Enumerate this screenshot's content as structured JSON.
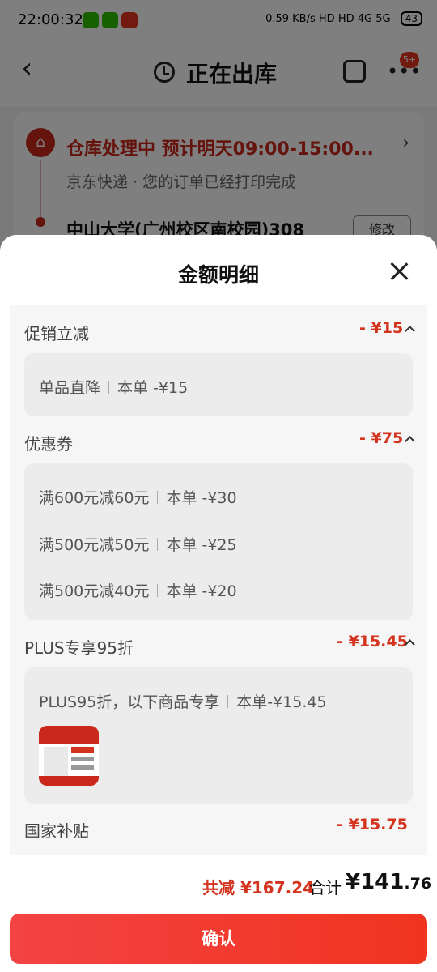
{
  "status_bar": {
    "time": "22:00:32",
    "net_speed": "0.59 KB/s",
    "signal": "HD HD 4G 5G",
    "battery": "43"
  },
  "navbar": {
    "title": "正在出库",
    "badge": "5+"
  },
  "order_card": {
    "status": "仓库处理中  预计明天09:00-15:00...",
    "sub": "京东快递 · 您的订单已经打印完成",
    "address": "中山大学(广州校区南校园)308",
    "modify_label": "修改"
  },
  "sheet": {
    "title": "金额明细",
    "sections": [
      {
        "title": "促销立减",
        "amount": "- ¥15",
        "items": [
          {
            "name": "单品直降",
            "detail": "本单 -¥15"
          }
        ]
      },
      {
        "title": "优惠券",
        "amount": "- ¥75",
        "items": [
          {
            "name": "满600元减60元",
            "detail": "本单 -¥30"
          },
          {
            "name": "满500元减50元",
            "detail": "本单 -¥25"
          },
          {
            "name": "满500元减40元",
            "detail": "本单 -¥20"
          }
        ]
      },
      {
        "title": "PLUS专享95折",
        "amount": "- ¥15.45",
        "items": [
          {
            "name": "PLUS95折，以下商品专享",
            "detail": "本单-¥15.45"
          }
        ],
        "has_thumbnail": true
      },
      {
        "title": "国家补贴",
        "amount": "- ¥15.75"
      }
    ]
  },
  "footer": {
    "total_reduce": "共减 ¥167.24",
    "total_label": "合计",
    "total_currency": "¥",
    "total_int": "141",
    "total_dec": ".76",
    "confirm_label": "确认"
  },
  "colors": {
    "accent_red": "#d4331e",
    "button_red": "#f0341f"
  }
}
